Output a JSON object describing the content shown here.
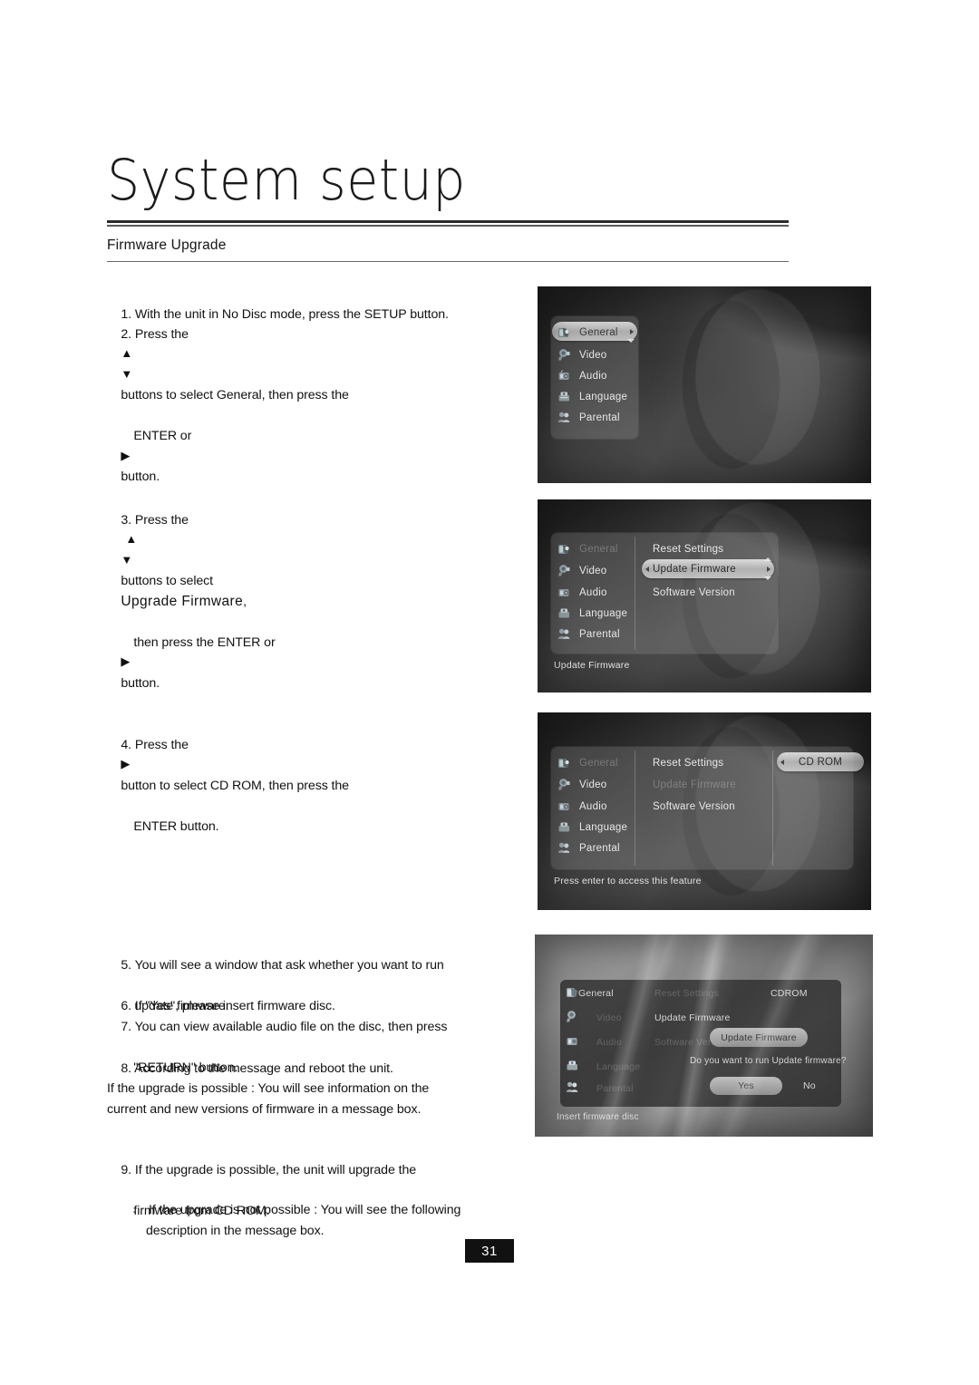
{
  "page": {
    "title": "System setup",
    "section": "Firmware Upgrade",
    "number": "31"
  },
  "instructions": {
    "step1": "1. With the unit in No Disc mode, press the SETUP button.",
    "step2_a": "2. Press the",
    "step2_up": "▲",
    "step2_down": "▼",
    "step2_b": "buttons to select General, then press the",
    "step2_c": "ENTER or",
    "step2_right": "▶",
    "step2_d": "button.",
    "step3_a": "3. Press the",
    "step3_up": "▲",
    "step3_down": "▼",
    "step3_b": "buttons to select",
    "step3_emph": "Upgrade Firmware",
    "step3_comma": ",",
    "step3_c": "then press the ENTER or",
    "step3_right": "▶",
    "step3_d": "button.",
    "step4_a": "4. Press the",
    "step4_right": "▶",
    "step4_b": "button to select CD ROM, then press the",
    "step4_c": "ENTER button.",
    "step5_a": "5. You will see a window that ask whether you want to run",
    "step5_b": "update firmware.",
    "step6": "6. If \"Yes\", please insert firmware disc.",
    "step7_a": "7. You can view available audio file on the disc, then press",
    "step7_b": "\"RETURN\" button.",
    "step8": "8. According to the message and reboot the unit.",
    "para_a": "If the upgrade is possible : You will see information on the",
    "para_b": "current and new versions of firmware in a message box.",
    "step9_a": "9. If the upgrade is possible, the unit will upgrade the",
    "step9_b": "firmware from CD ROM.",
    "bullet_mark": "·",
    "bullet_a": "If the upgrade is not possible : You will see the following",
    "bullet_b": "description in the message box."
  },
  "screens": {
    "menu_items": [
      {
        "label": "General",
        "icon": "general-icon"
      },
      {
        "label": "Video",
        "icon": "video-icon"
      },
      {
        "label": "Audio",
        "icon": "audio-icon"
      },
      {
        "label": "Language",
        "icon": "language-icon"
      },
      {
        "label": "Parental",
        "icon": "parental-icon"
      }
    ],
    "general_submenu": [
      {
        "label": "Reset Settings"
      },
      {
        "label": "Update Firmware"
      },
      {
        "label": "Software Version"
      }
    ],
    "shot1": {
      "selected": "General"
    },
    "shot2": {
      "selected": "Update Firmware",
      "status": "Update Firmware"
    },
    "shot3": {
      "selected": "CD ROM",
      "source_option": "CD ROM",
      "status": "Press enter to access this feature"
    },
    "shot4": {
      "general_label": "General",
      "cdrom_label": "CDROM",
      "submenu_label": "Update Firmware",
      "dialog_title": "Update Firmware",
      "dialog_question": "Do you want to run Update firmware?",
      "yes_label": "Yes",
      "no_label": "No",
      "status": "Insert firmware disc"
    }
  },
  "colors": {
    "rule_dark": "#2b2b2b",
    "page_number_bg": "#111111",
    "osd_highlight": "#dcdcdc",
    "osd_text": "#e8e8e8"
  }
}
